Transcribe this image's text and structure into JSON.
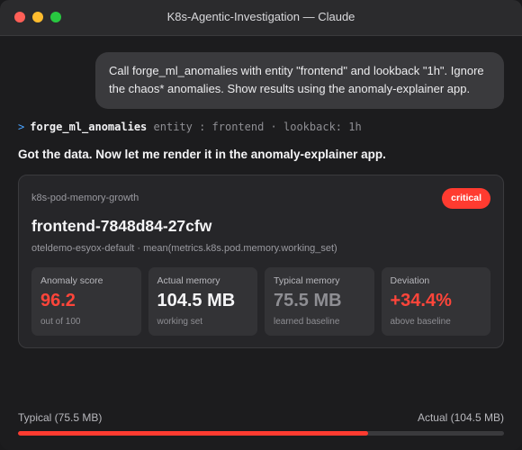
{
  "window": {
    "title": "K8s-Agentic-Investigation — Claude",
    "traffic_lights": [
      "close",
      "minimize",
      "zoom"
    ]
  },
  "conversation": {
    "user_message": "Call forge_ml_anomalies with entity \"frontend\" and lookback \"1h\". Ignore the chaos* anomalies. Show results using the anomaly-explainer app.",
    "tool_call": {
      "prompt": ">",
      "name": "forge_ml_anomalies",
      "args": "entity : frontend · lookback: 1h"
    },
    "assistant_message": "Got the data. Now let me render it in the anomaly-explainer app."
  },
  "anomaly_card": {
    "kind": "k8s-pod-memory-growth",
    "severity": "critical",
    "pod_name": "frontend-7848d84-27cfw",
    "metric_path": "oteldemo-esyox-default · mean(metrics.k8s.pod.memory.working_set)",
    "stats": [
      {
        "label": "Anomaly score",
        "value": "96.2",
        "sub": "out of 100",
        "tone": "red"
      },
      {
        "label": "Actual memory",
        "value": "104.5 MB",
        "sub": "working set",
        "tone": "white"
      },
      {
        "label": "Typical memory",
        "value": "75.5 MB",
        "sub": "learned baseline",
        "tone": "gray"
      },
      {
        "label": "Deviation",
        "value": "+34.4%",
        "sub": "above baseline",
        "tone": "red"
      }
    ]
  },
  "comparison_bar": {
    "left_label": "Typical (75.5 MB)",
    "right_label": "Actual (104.5 MB)",
    "fill_fraction": 0.72
  },
  "colors": {
    "accent_red": "#ff3b30",
    "prompt_blue": "#4aa3ff"
  }
}
